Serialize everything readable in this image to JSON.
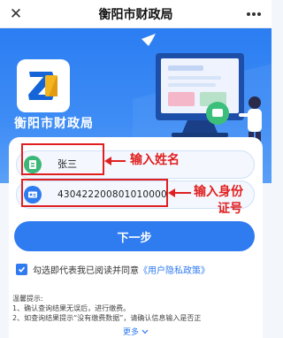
{
  "header": {
    "title": "衡阳市财政局",
    "close_label": "✕"
  },
  "hero": {
    "agency_name": "衡阳市财政局"
  },
  "form": {
    "name_value": "张三",
    "id_value": "430422200801010000",
    "next_label": "下一步"
  },
  "annotations": {
    "name_hint": "输入姓名",
    "id_hint_line1": "输入身份",
    "id_hint_line2": "证号"
  },
  "agreement": {
    "text": "勾选即代表我已阅读并同意",
    "link": "《用户隐私政策》",
    "checked": true
  },
  "tips": {
    "heading": "温馨提示:",
    "line1": "1、确认查询结果无误后，进行缴费。",
    "line2": "2、如查询结果提示“没有缴费数据”，请确认信息输入是否正"
  },
  "more": {
    "label": "更多"
  },
  "colors": {
    "primary": "#2f7bf0",
    "annotation": "#e02020",
    "hero_top": "#2b7df2"
  },
  "icons": {
    "close": "close-icon",
    "more": "more-dots-icon",
    "name_field": "person-card-icon",
    "id_field": "id-card-icon",
    "check": "checkbox-checked-icon",
    "expand": "chevron-down-icon"
  }
}
